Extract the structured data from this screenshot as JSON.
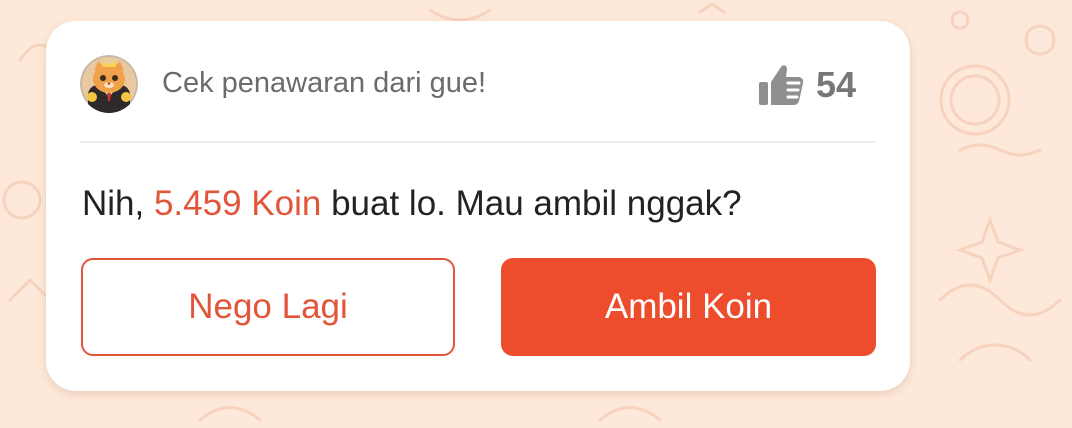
{
  "offer_card": {
    "title": "Cek penawaran dari gue!",
    "avatar_icon": "cat-mascot-icon",
    "likes": {
      "icon": "thumbs-up-icon",
      "count": "54"
    },
    "message": {
      "prefix": "Nih, ",
      "highlight": "5.459 Koin",
      "suffix": " buat lo. Mau ambil nggak?"
    },
    "negotiate_button": "Nego Lagi",
    "accept_button": "Ambil Koin"
  },
  "colors": {
    "background": "#fde8d9",
    "accent": "#ee4d2d",
    "highlight_text": "#e2553a",
    "muted_text": "#6b6b6b"
  }
}
